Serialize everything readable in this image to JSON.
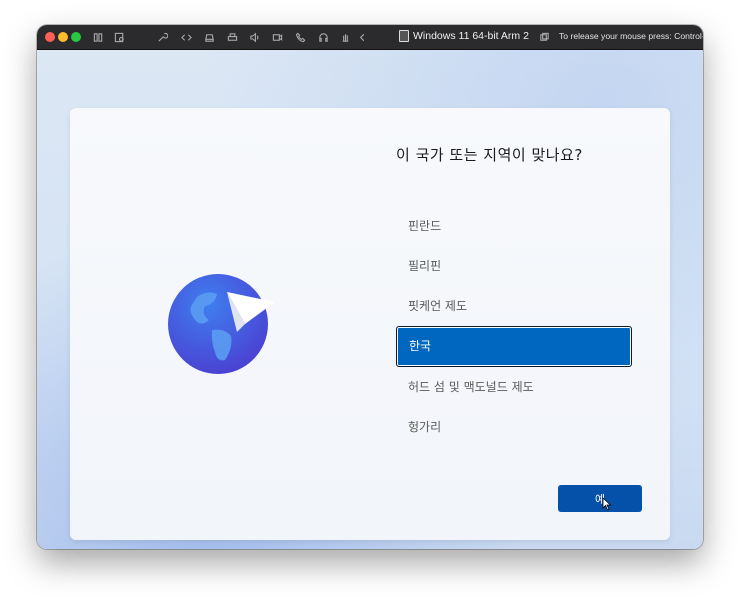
{
  "window": {
    "title": "Windows 11 64-bit Arm 2",
    "release_hint": "To release your mouse press: Control-⌘"
  },
  "toolbar_icons": [
    "sidebar-icon",
    "vm-settings-icon",
    "wrench-icon",
    "code-icon",
    "drive-icon",
    "printer-icon",
    "speaker-icon",
    "camera-icon",
    "phone-icon",
    "headphones-icon",
    "hand-icon",
    "back-chevron-icon",
    "window-overlay-icon"
  ],
  "setup": {
    "heading": "이 국가 또는 지역이 맞나요?",
    "regions": [
      {
        "label": "핀란드",
        "selected": false
      },
      {
        "label": "필리핀",
        "selected": false
      },
      {
        "label": "핏케언 제도",
        "selected": false
      },
      {
        "label": "한국",
        "selected": true
      },
      {
        "label": "허드 섬 및 맥도널드 제도",
        "selected": false
      },
      {
        "label": "헝가리",
        "selected": false
      }
    ],
    "yes_button": "예"
  },
  "taskbar_icons": [
    "accessibility-icon",
    "volume-icon"
  ],
  "colors": {
    "accent": "#0067c0",
    "button": "#0550a8"
  }
}
